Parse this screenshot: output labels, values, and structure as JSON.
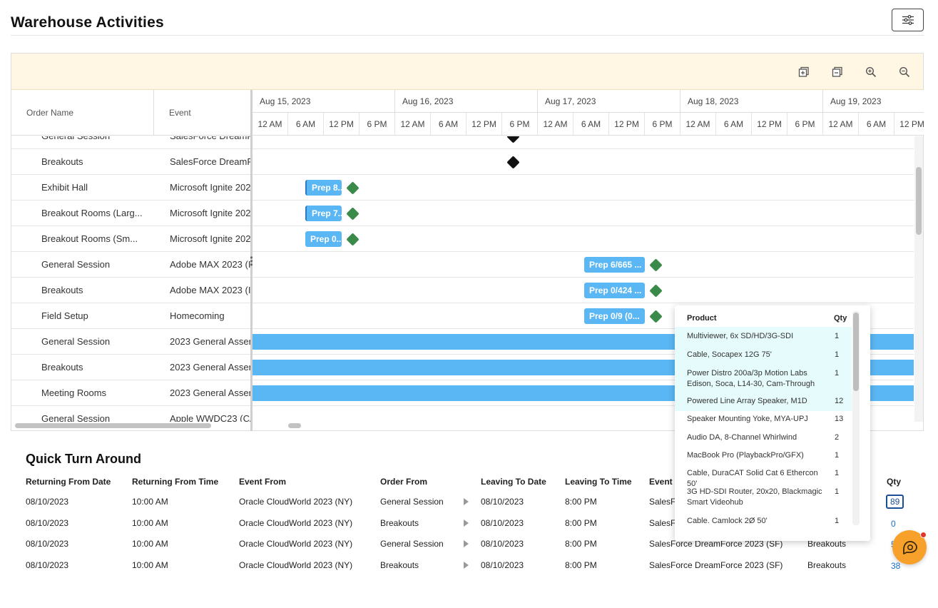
{
  "page": {
    "title": "Warehouse Activities"
  },
  "gantt": {
    "columns": {
      "order_name": "Order Name",
      "event": "Event"
    },
    "days": [
      "Aug 15, 2023",
      "Aug 16, 2023",
      "Aug 17, 2023",
      "Aug 18, 2023",
      "Aug 19, 2023"
    ],
    "hours": [
      "12 AM",
      "6 AM",
      "12 PM",
      "6 PM"
    ],
    "rows": [
      {
        "order": "General Session",
        "event": "SalesForce DreamF"
      },
      {
        "order": "Breakouts",
        "event": "SalesForce DreamF"
      },
      {
        "order": "Exhibit Hall",
        "event": "Microsoft Ignite 202"
      },
      {
        "order": "Breakout Rooms (Larg...",
        "event": "Microsoft Ignite 202"
      },
      {
        "order": "Breakout Rooms (Sm...",
        "event": "Microsoft Ignite 202"
      },
      {
        "order": "General Session",
        "event": "Adobe MAX 2023 (I"
      },
      {
        "order": "Breakouts",
        "event": "Adobe MAX 2023 (I"
      },
      {
        "order": "Field Setup",
        "event": "Homecoming"
      },
      {
        "order": "General Session",
        "event": "2023 General Asser"
      },
      {
        "order": "Breakouts",
        "event": "2023 General Asser"
      },
      {
        "order": "Meeting Rooms",
        "event": "2023 General Asser"
      },
      {
        "order": "General Session",
        "event": "Apple WWDC23 (CA"
      }
    ],
    "bars": {
      "exhibit_hall": "Prep 8...",
      "breakout_large": "Prep 7...",
      "breakout_small": "Prep 0...",
      "adobe_general": "Prep 6/665 ...",
      "adobe_breakouts": "Prep 0/424 ...",
      "field_setup": "Prep 0/9 (0..."
    },
    "colors": {
      "bar": "#5ab7f4",
      "milestone_done": "#3a8a4a",
      "milestone_pending": "#111111",
      "toolbar_bg": "#fff6e3"
    }
  },
  "popup": {
    "header": {
      "product": "Product",
      "qty": "Qty"
    },
    "items": [
      {
        "product": "Multiviewer, 6x SD/HD/3G-SDI",
        "qty": "1"
      },
      {
        "product": "Cable, Socapex 12G 75'",
        "qty": "1"
      },
      {
        "product": "Power Distro 200a/3p Motion Labs Edison, Soca, L14-30, Cam-Through",
        "qty": "1"
      },
      {
        "product": "Powered Line Array Speaker, M1D",
        "qty": "12"
      },
      {
        "product": "Speaker Mounting Yoke, MYA-UPJ",
        "qty": "13"
      },
      {
        "product": "Audio DA, 8-Channel Whirlwind",
        "qty": "2"
      },
      {
        "product": "MacBook Pro (PlaybackPro/GFX)",
        "qty": "1"
      },
      {
        "product": "Cable, DuraCAT Solid Cat 6 Ethercon 50'",
        "qty": "1"
      },
      {
        "product": "3G HD-SDI Router, 20x20, Blackmagic Smart Videohub",
        "qty": "1"
      },
      {
        "product": "Cable. Camlock 2Ø 50'",
        "qty": "1"
      }
    ]
  },
  "quick_turn": {
    "title": "Quick Turn Around",
    "headers": [
      "Returning From Date",
      "Returning From Time",
      "Event From",
      "Order From",
      "Leaving To Date",
      "Leaving To Time",
      "Event",
      "Qty"
    ],
    "rows": [
      {
        "ret_date": "08/10/2023",
        "ret_time": "10:00 AM",
        "event_from": "Oracle CloudWorld 2023 (NY)",
        "order_from": "General Session",
        "leave_date": "08/10/2023",
        "leave_time": "8:00 PM",
        "event_to": "SalesF",
        "order_to": "",
        "qty": "89"
      },
      {
        "ret_date": "08/10/2023",
        "ret_time": "10:00 AM",
        "event_from": "Oracle CloudWorld 2023 (NY)",
        "order_from": "Breakouts",
        "leave_date": "08/10/2023",
        "leave_time": "8:00 PM",
        "event_to": "SalesF",
        "order_to": "",
        "qty": "0"
      },
      {
        "ret_date": "08/10/2023",
        "ret_time": "10:00 AM",
        "event_from": "Oracle CloudWorld 2023 (NY)",
        "order_from": "General Session",
        "leave_date": "08/10/2023",
        "leave_time": "8:00 PM",
        "event_to": "SalesForce DreamForce 2023 (SF)",
        "order_to": "Breakouts",
        "qty": "5"
      },
      {
        "ret_date": "08/10/2023",
        "ret_time": "10:00 AM",
        "event_from": "Oracle CloudWorld 2023 (NY)",
        "order_from": "Breakouts",
        "leave_date": "08/10/2023",
        "leave_time": "8:00 PM",
        "event_to": "SalesForce DreamForce 2023 (SF)",
        "order_to": "Breakouts",
        "qty": "38"
      }
    ]
  },
  "icons": {
    "settings": "sliders-icon",
    "expand_all": "expand-all-icon",
    "collapse_all": "collapse-all-icon",
    "zoom_in": "zoom-in-icon",
    "zoom_out": "zoom-out-icon",
    "chat": "chat-support-icon"
  }
}
